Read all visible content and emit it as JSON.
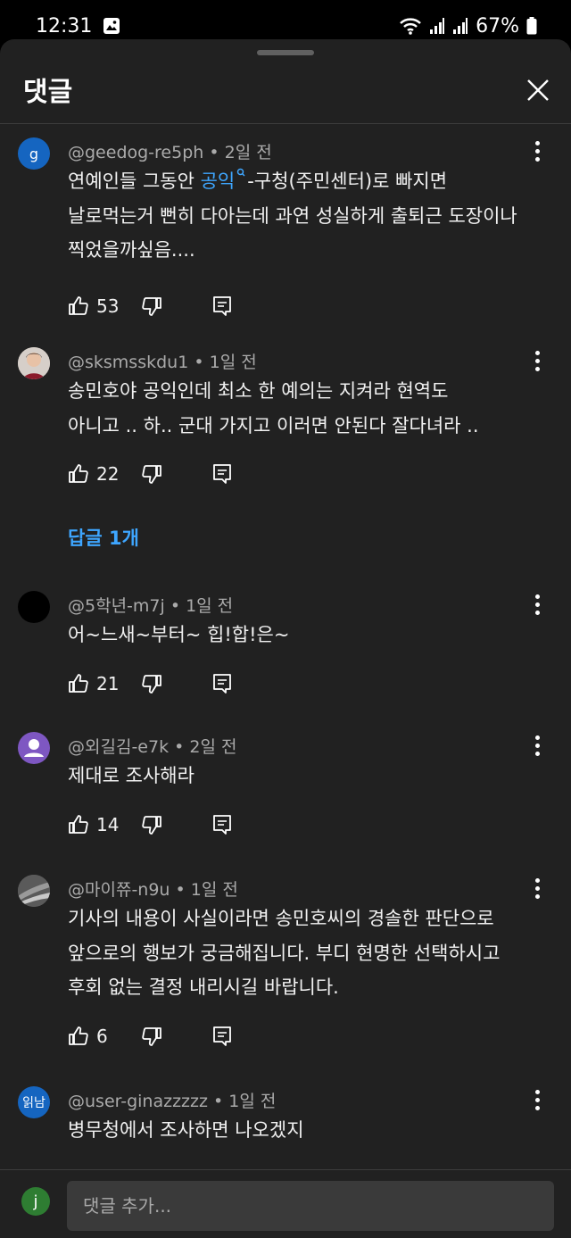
{
  "status_bar": {
    "time": "12:31",
    "battery": "67%"
  },
  "header": {
    "title": "댓글"
  },
  "comments": [
    {
      "author": "@geedog-re5ph",
      "time": "2일 전",
      "avatar_letter": "g",
      "avatar_color": "#1565c0",
      "lines": [
        "연예인들 그동안 ",
        "공익",
        "-구청(주민센터)로 빠지면",
        "날로먹는거 뻔히 다아는데 과연 성실하게 출퇴근 도장이나",
        "찍었을까싶음...."
      ],
      "likes": "53"
    },
    {
      "author": "@sksmsskdu1",
      "time": "1일 전",
      "lines": [
        "송민호야 공익인데 최소 한 예의는 지켜라 현역도",
        "아니고 .. 하.. 군대 가지고 이러면 안된다 잘다녀라 .."
      ],
      "likes": "22",
      "replies": "답글 1개"
    },
    {
      "author": "@5학년-m7j",
      "time": "1일 전",
      "lines": [
        "어~느새~부터~ 힙!합!은~"
      ],
      "likes": "21"
    },
    {
      "author": "@외길김-e7k",
      "time": "2일 전",
      "avatar_color": "#7e57c2",
      "lines": [
        "제대로 조사해라"
      ],
      "likes": "14"
    },
    {
      "author": "@마이쮸-n9u",
      "time": "1일 전",
      "lines": [
        "기사의 내용이  사실이라면 송민호씨의 경솔한 판단으로",
        "앞으로의 행보가 궁금해집니다. 부디 현명한 선택하시고",
        "후회 없는 결정 내리시길 바랍니다."
      ],
      "likes": "6"
    },
    {
      "author": "@user-ginazzzzz",
      "time": "1일 전",
      "avatar_letter": "읽남",
      "avatar_color": "#1565c0",
      "lines": [
        "병무청에서 조사하면 나오겠지"
      ]
    }
  ],
  "composer": {
    "avatar_letter": "j",
    "placeholder": "댓글 추가..."
  }
}
